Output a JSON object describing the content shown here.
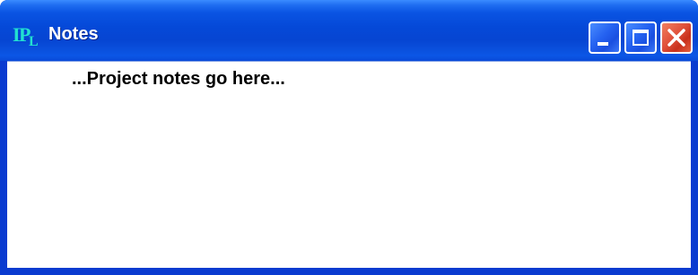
{
  "window": {
    "title": "Notes",
    "content_text": "...Project notes go here...",
    "controls": {
      "minimize": "minimize-icon",
      "maximize": "maximize-icon",
      "close": "close-icon"
    },
    "colors": {
      "titlebar": "#0a54e3",
      "frame": "#0a3bd0",
      "close_button": "#e0503a"
    }
  }
}
